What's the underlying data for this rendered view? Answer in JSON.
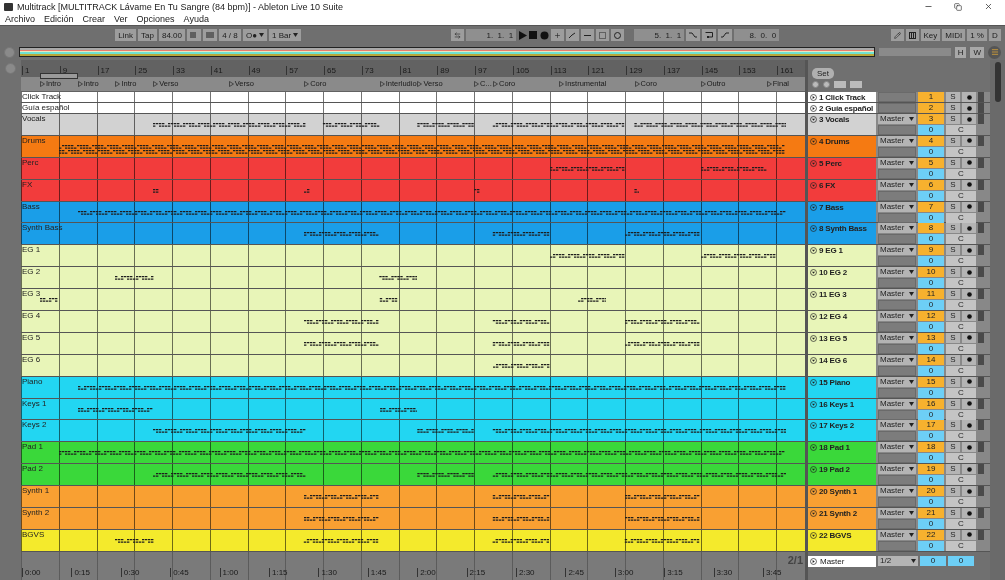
{
  "window": {
    "title": "Multitrack  [MULTITRACK Lávame En Tu Sangre (84 bpm)] - Ableton Live 10 Suite"
  },
  "menu": [
    "Archivo",
    "Edición",
    "Crear",
    "Ver",
    "Opciones",
    "Ayuda"
  ],
  "toolbar": {
    "link": "Link",
    "tap": "Tap",
    "tempo": "84.00",
    "signature": "4 / 8",
    "metronome": "O●",
    "quantize": "1 Bar",
    "position": "1.  1.  1",
    "loop_start": "5.  1.  1",
    "loop_length": "8.  0.  0",
    "key": "Key",
    "midi": "MIDI",
    "cpu": "1 %",
    "disk": "D"
  },
  "overview": {
    "h": "H",
    "w": "W"
  },
  "ruler": {
    "bars": [
      "1",
      "9",
      "17",
      "25",
      "33",
      "41",
      "49",
      "57",
      "65",
      "73",
      "81",
      "89",
      "97",
      "105",
      "113",
      "121",
      "129",
      "137",
      "145",
      "153",
      "161"
    ]
  },
  "locators": [
    "Intro",
    "Intro",
    "Intro",
    "Verso",
    "Verso",
    "Coro",
    "Interludio",
    "Verso",
    "C...",
    "Coro",
    "Instrumental",
    "Coro",
    "Outro",
    "Final"
  ],
  "set_button": "Set",
  "tracks": [
    {
      "kind": "compact",
      "title": "1 Click Track",
      "lane_label": "Click Track",
      "number": "1",
      "solo": "S",
      "color": "#ffffff",
      "expanded": false
    },
    {
      "kind": "compact",
      "title": "2 Guía español",
      "lane_label": "Guía español",
      "number": "2",
      "solo": "S",
      "color": "#ffffff",
      "expanded": false
    },
    {
      "kind": "full",
      "title": "3 Vocals",
      "lane_label": "Vocals",
      "number": "3",
      "solo": "S",
      "routing": "Master",
      "volume": "0",
      "pan": "C",
      "color": "#d2d2d2",
      "expanded": true
    },
    {
      "kind": "full",
      "title": "4 Drums",
      "lane_label": "Drums",
      "number": "4",
      "solo": "S",
      "routing": "Master",
      "volume": "0",
      "pan": "C",
      "color": "#f57a12",
      "expanded": true
    },
    {
      "kind": "full",
      "title": "5 Perc",
      "lane_label": "Perc",
      "number": "5",
      "solo": "S",
      "routing": "Master",
      "volume": "0",
      "pan": "C",
      "color": "#f23c3c",
      "expanded": true
    },
    {
      "kind": "full",
      "title": "6 FX",
      "lane_label": "FX",
      "number": "6",
      "solo": "S",
      "routing": "Master",
      "volume": "0",
      "pan": "C",
      "color": "#f23c3c",
      "expanded": true
    },
    {
      "kind": "full",
      "title": "7 Bass",
      "lane_label": "Bass",
      "number": "7",
      "solo": "S",
      "routing": "Master",
      "volume": "0",
      "pan": "C",
      "color": "#1a9ee8",
      "expanded": true
    },
    {
      "kind": "full",
      "title": "8 Synth Bass",
      "lane_label": "Synth Bass",
      "number": "8",
      "solo": "S",
      "routing": "Master",
      "volume": "0",
      "pan": "C",
      "color": "#1a9ee8",
      "expanded": true
    },
    {
      "kind": "full",
      "title": "9 EG 1",
      "lane_label": "EG 1",
      "number": "9",
      "solo": "S",
      "routing": "Master",
      "volume": "0",
      "pan": "C",
      "color": "#e8f5b8",
      "expanded": true
    },
    {
      "kind": "full",
      "title": "10 EG 2",
      "lane_label": "EG 2",
      "number": "10",
      "solo": "S",
      "routing": "Master",
      "volume": "0",
      "pan": "C",
      "color": "#e8f5b8",
      "expanded": true
    },
    {
      "kind": "full",
      "title": "11 EG 3",
      "lane_label": "EG 3",
      "number": "11",
      "solo": "S",
      "routing": "Master",
      "volume": "0",
      "pan": "C",
      "color": "#e8f5b8",
      "expanded": true
    },
    {
      "kind": "full",
      "title": "12 EG 4",
      "lane_label": "EG 4",
      "number": "12",
      "solo": "S",
      "routing": "Master",
      "volume": "0",
      "pan": "C",
      "color": "#e8f5b8",
      "expanded": true
    },
    {
      "kind": "full",
      "title": "13 EG 5",
      "lane_label": "EG 5",
      "number": "13",
      "solo": "S",
      "routing": "Master",
      "volume": "0",
      "pan": "C",
      "color": "#e8f5b8",
      "expanded": true
    },
    {
      "kind": "full",
      "title": "14 EG 6",
      "lane_label": "EG 6",
      "number": "14",
      "solo": "S",
      "routing": "Master",
      "volume": "0",
      "pan": "C",
      "color": "#e8f5b8",
      "expanded": true
    },
    {
      "kind": "full",
      "title": "15 Piano",
      "lane_label": "Piano",
      "number": "15",
      "solo": "S",
      "routing": "Master",
      "volume": "0",
      "pan": "C",
      "color": "#22d6f2",
      "expanded": true
    },
    {
      "kind": "full",
      "title": "16 Keys 1",
      "lane_label": "Keys 1",
      "number": "16",
      "solo": "S",
      "routing": "Master",
      "volume": "0",
      "pan": "C",
      "color": "#22d6f2",
      "expanded": true
    },
    {
      "kind": "full",
      "title": "17 Keys 2",
      "lane_label": "Keys 2",
      "number": "17",
      "solo": "S",
      "routing": "Master",
      "volume": "0",
      "pan": "C",
      "color": "#22d6f2",
      "expanded": true
    },
    {
      "kind": "full",
      "title": "18 Pad 1",
      "lane_label": "Pad 1",
      "number": "18",
      "solo": "S",
      "routing": "Master",
      "volume": "0",
      "pan": "C",
      "color": "#3ad83a",
      "expanded": true
    },
    {
      "kind": "full",
      "title": "19 Pad 2",
      "lane_label": "Pad 2",
      "number": "19",
      "solo": "S",
      "routing": "Master",
      "volume": "0",
      "pan": "C",
      "color": "#3ad83a",
      "expanded": true
    },
    {
      "kind": "full",
      "title": "20 Synth 1",
      "lane_label": "Synth 1",
      "number": "20",
      "solo": "S",
      "routing": "Master",
      "volume": "0",
      "pan": "C",
      "color": "#f9a032",
      "expanded": true
    },
    {
      "kind": "full",
      "title": "21 Synth 2",
      "lane_label": "Synth 2",
      "number": "21",
      "solo": "S",
      "routing": "Master",
      "volume": "0",
      "pan": "C",
      "color": "#f9a032",
      "expanded": true
    },
    {
      "kind": "full",
      "title": "22 BGVS",
      "lane_label": "BGVS",
      "number": "22",
      "solo": "S",
      "routing": "Master",
      "volume": "0",
      "pan": "C",
      "color": "#f4ea2c",
      "expanded": true
    }
  ],
  "zoom_label": "2/1",
  "master": {
    "name": "Master",
    "routing": "1/2",
    "volume": "0",
    "pan": "0"
  },
  "timeline": [
    "0:00",
    "0:15",
    "0:30",
    "0:45",
    "1:00",
    "1:15",
    "1:30",
    "1:45",
    "2:00",
    "2:15",
    "2:30",
    "2:45",
    "3:00",
    "3:15",
    "3:30",
    "3:45"
  ]
}
